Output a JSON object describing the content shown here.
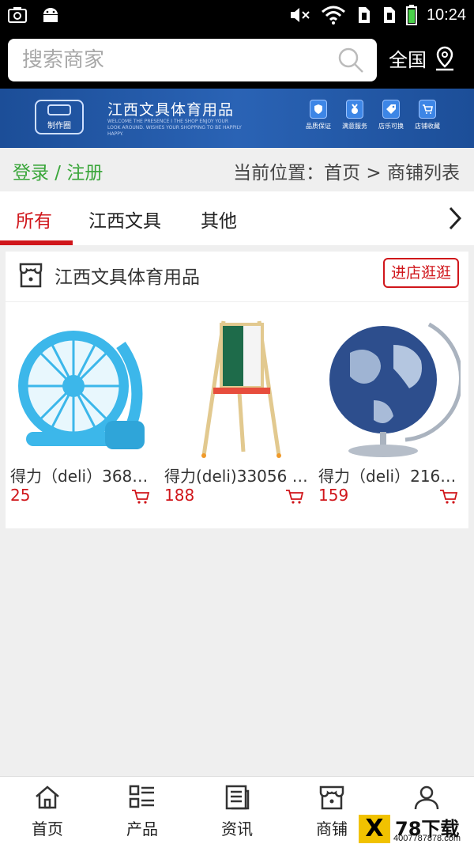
{
  "status_bar": {
    "time": "10:24"
  },
  "header": {
    "search_placeholder": "搜索商家",
    "region_label": "全国"
  },
  "banner": {
    "logo_text": "制作圈",
    "title": "江西文具体育用品",
    "subtitle": "WELCOME THE PRESENCE I THE SHOP ENJOY YOUR LOOK AROUND. WISHES YOUR SHOPPING TO BE HAPPILY HAPPY.",
    "features": [
      {
        "icon": "shield-icon",
        "label": "品质保证"
      },
      {
        "icon": "medal-icon",
        "label": "满意服务"
      },
      {
        "icon": "tag-icon",
        "label": "店乐可换"
      },
      {
        "icon": "cart-icon",
        "label": "店铺收藏"
      }
    ]
  },
  "nav_row": {
    "login_label": "登录 / 注册",
    "location_label": "当前位置：首页 > 商铺列表"
  },
  "tabs": [
    {
      "label": "所有",
      "active": true
    },
    {
      "label": "江西文具",
      "active": false
    },
    {
      "label": "其他",
      "active": false
    }
  ],
  "store": {
    "name": "江西文具体育用品",
    "visit_label": "进店逛逛",
    "products": [
      {
        "name": "得力（deli）368…",
        "price": "25"
      },
      {
        "name": "得力(deli)33056 …",
        "price": "188"
      },
      {
        "name": "得力（deli）216…",
        "price": "159"
      }
    ]
  },
  "bottom_nav": [
    {
      "icon": "home-icon",
      "label": "首页"
    },
    {
      "icon": "products-icon",
      "label": "产品"
    },
    {
      "icon": "news-icon",
      "label": "资讯"
    },
    {
      "icon": "store-icon",
      "label": "商铺"
    },
    {
      "icon": "user-icon",
      "label": ""
    }
  ],
  "watermark": {
    "logo_letter": "X",
    "title": "78下载",
    "url": "4007787878.com"
  },
  "colors": {
    "accent": "#d0161b",
    "login": "#3aa63a",
    "banner": "#1c4e98"
  }
}
